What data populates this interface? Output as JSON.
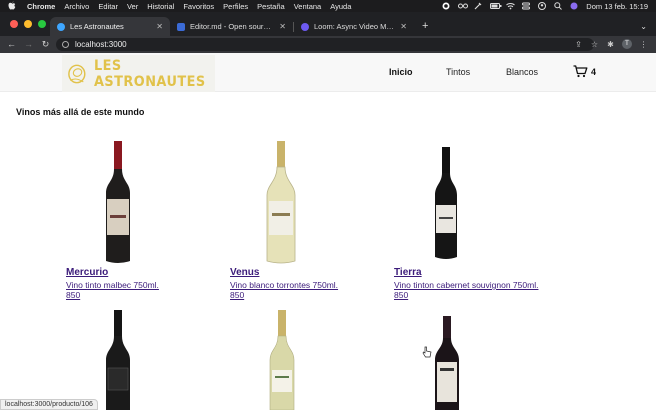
{
  "menubar": {
    "app": "Chrome",
    "items": [
      "Archivo",
      "Editar",
      "Ver",
      "Historial",
      "Favoritos",
      "Perfiles",
      "Pestaña",
      "Ventana",
      "Ayuda"
    ],
    "datetime": "Dom 13 feb.  15:19"
  },
  "browser": {
    "tabs": [
      {
        "title": "Les Astronautes",
        "active": true,
        "favicon_color": "#3ea6ff"
      },
      {
        "title": "Editor.md - Open source online",
        "active": false,
        "favicon_color": "#3b6bd6"
      },
      {
        "title": "Loom: Async Video Messaging",
        "active": false,
        "favicon_color": "#6d5af1"
      }
    ],
    "url": "localhost:3000",
    "profile_initial": "T",
    "status_url": "localhost:3000/producto/106"
  },
  "site": {
    "logo_text": "LES ASTRONAUTES",
    "nav": [
      {
        "label": "Inicio",
        "active": true
      },
      {
        "label": "Tintos",
        "active": false
      },
      {
        "label": "Blancos",
        "active": false
      }
    ],
    "cart_count": "4",
    "section_title": "Vinos más allá de este mundo",
    "products": [
      {
        "name": "Mercurio",
        "description": "Vino tinto malbec 750ml.",
        "price": "850",
        "bottle": "red"
      },
      {
        "name": "Venus",
        "description": "Vino blanco torrontes 750ml.",
        "price": "850",
        "bottle": "white"
      },
      {
        "name": "Tierra",
        "description": "Vino tinton cabernet souvignon 750ml.",
        "price": "850",
        "bottle": "dark"
      },
      {
        "name": "",
        "description": "",
        "price": "",
        "bottle": "dark"
      },
      {
        "name": "",
        "description": "",
        "price": "",
        "bottle": "white"
      },
      {
        "name": "",
        "description": "",
        "price": "",
        "bottle": "dark"
      }
    ]
  },
  "colors": {
    "link": "#3b1b7a",
    "logo_gold": "#e1c24a",
    "header_bg": "#f8f8f8"
  }
}
